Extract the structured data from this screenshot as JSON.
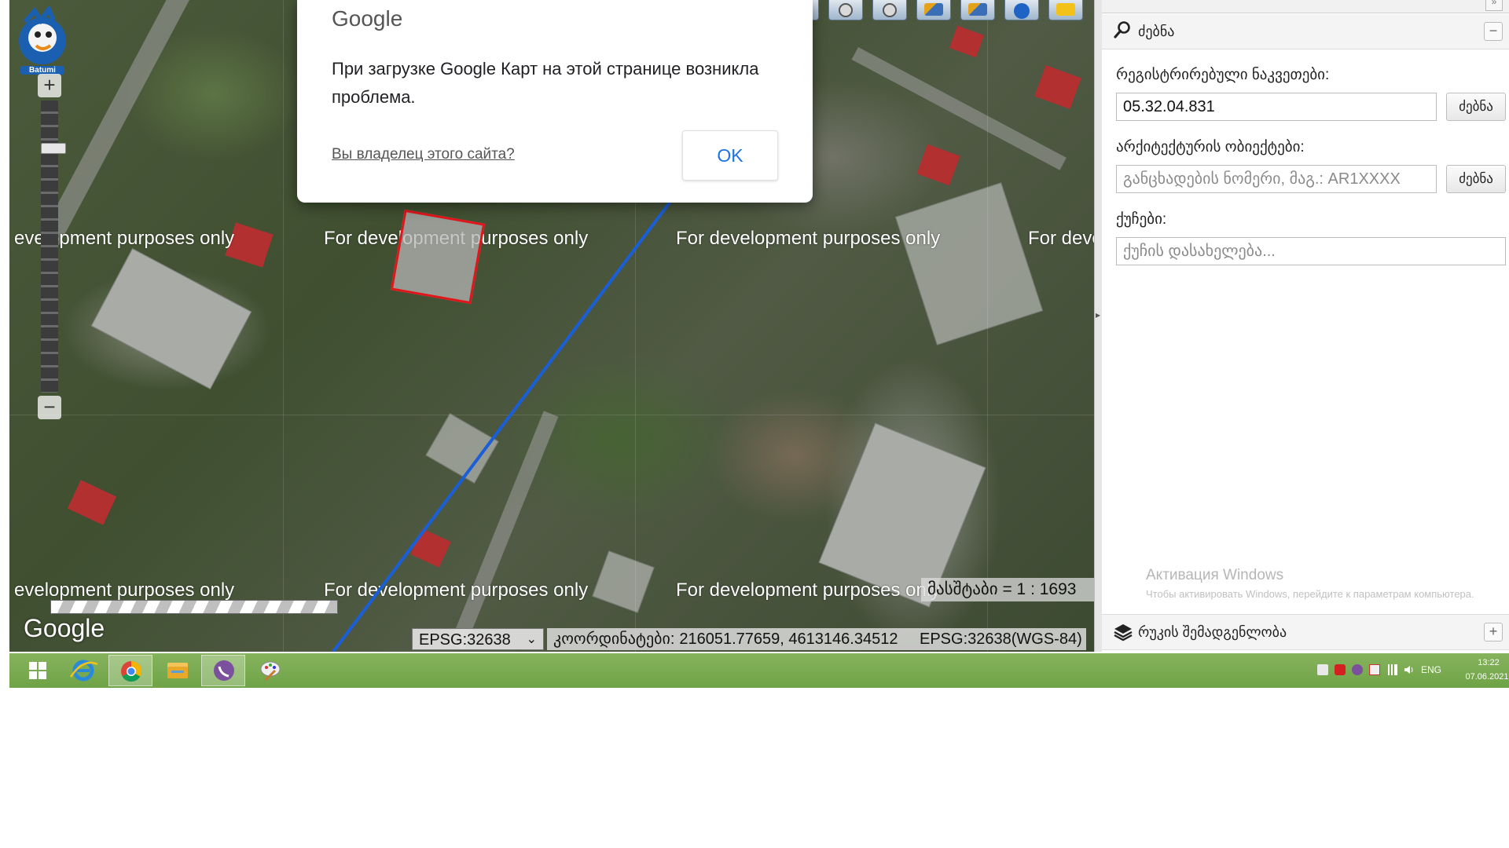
{
  "dialog": {
    "brand": "Google",
    "message": "При загрузке Google Карт на этой странице возникла проблема.",
    "owner_link": "Вы владелец этого сайта?",
    "ok_label": "OK"
  },
  "map": {
    "watermark": "For development purposes only",
    "watermark_partial_left": "evelopment purposes only",
    "watermark_partial_right": "For deve",
    "google_mark": "Google",
    "logo_text": "Batumi",
    "scale_text": "მასშტაბი = 1 : 1693",
    "projection_selected": "EPSG:32638",
    "coord_label": "კოორდინატები:",
    "coord_value": "216051.77659, 4613146.34512",
    "coord_srs": "EPSG:32638(WGS-84)"
  },
  "toolbar": {
    "tools": [
      "info-icon",
      "identify-icon",
      "measure-length-icon",
      "measure-area-icon",
      "pan-icon",
      "zoom-in-icon",
      "zoom-out-icon",
      "draw-prev-icon",
      "draw-next-icon",
      "globe-icon",
      "eraser-icon"
    ]
  },
  "panel": {
    "search_title": "ძებნა",
    "registered_label": "რეგისტრირებული ნაკვეთები:",
    "registered_value": "05.32.04.831",
    "registered_button": "ძებნა",
    "arch_label": "არქიტექტურის ობიექტები:",
    "arch_placeholder": "განცხადების ნომერი, მაგ.: AR1XXXX",
    "arch_button": "ძებნა",
    "streets_label": "ქუჩები:",
    "streets_placeholder": "ქუჩის დასახელება...",
    "win_activation_title": "Активация Windows",
    "win_activation_text": "Чтобы активировать Windows, перейдите к параметрам компьютера.",
    "layers_title": "რუკის შემადგენლობა"
  },
  "taskbar": {
    "apps": [
      "windows-start-icon",
      "internet-explorer-icon",
      "chrome-icon",
      "file-explorer-icon",
      "viber-icon",
      "paint-icon"
    ],
    "lang": "ENG",
    "time": "13:22",
    "date": "07.06.2021"
  }
}
